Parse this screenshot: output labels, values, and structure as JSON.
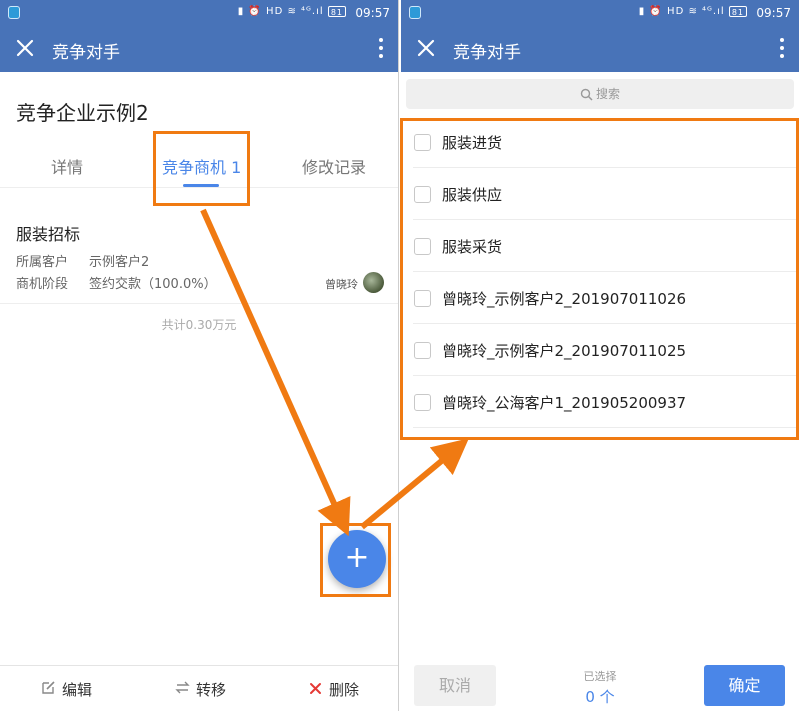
{
  "status_bar": {
    "time": "09:57",
    "battery": "81",
    "system_icons": "▮ ⏰ HD ≋ ⁴ᴳ.ıl"
  },
  "left": {
    "title": "竞争对手",
    "company_name": "竞争企业示例2",
    "tabs": [
      "详情",
      "竞争商机 1",
      "修改记录"
    ],
    "active_tab": 1,
    "opportunity": {
      "name": "服装招标",
      "customer_label": "所属客户",
      "customer_value": "示例客户2",
      "stage_label": "商机阶段",
      "stage_value": "签约交款（100.0%）",
      "owner": "曾晓玲"
    },
    "total": "共计0.30万元",
    "fab_label": "+",
    "actions": {
      "edit": "编辑",
      "transfer": "转移",
      "delete": "删除"
    }
  },
  "right": {
    "title": "竞争对手",
    "search_placeholder": "搜索",
    "items": [
      "服装进货",
      "服装供应",
      "服装采货",
      "曾晓玲_示例客户2_201907011026",
      "曾晓玲_示例客户2_201907011025",
      "曾晓玲_公海客户1_201905200937"
    ],
    "cancel_label": "取消",
    "selected_label": "已选择",
    "selected_count": "0 个",
    "confirm_label": "确定"
  },
  "colors": {
    "appbar": "#4873b8",
    "accent": "#4a86e8",
    "annotation": "#f07a12",
    "delete": "#e53935"
  }
}
